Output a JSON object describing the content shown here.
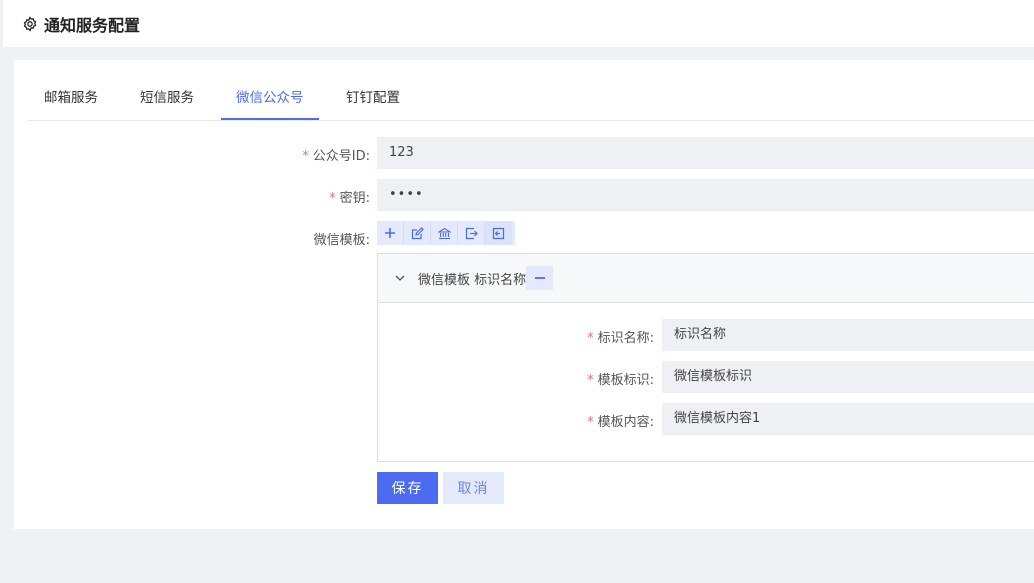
{
  "header": {
    "title": "通知服务配置",
    "icon": "gear-icon"
  },
  "tabs": [
    {
      "label": "邮箱服务",
      "active": false
    },
    {
      "label": "短信服务",
      "active": false
    },
    {
      "label": "微信公众号",
      "active": true
    },
    {
      "label": "钉钉配置",
      "active": false
    }
  ],
  "form": {
    "required_mark": "*",
    "app_id": {
      "label": "公众号ID:",
      "value": "123"
    },
    "secret": {
      "label": "密钥:",
      "value": "••••"
    },
    "templates": {
      "label": "微信模板:"
    }
  },
  "toolbar": {
    "icons": [
      "plus-icon",
      "edit-icon",
      "bank-icon",
      "export-icon",
      "import-icon"
    ]
  },
  "template_panel": {
    "title": "微信模板 标识名称",
    "fields": {
      "name": {
        "label": "标识名称:",
        "value": "标识名称"
      },
      "code": {
        "label": "模板标识:",
        "value": "微信模板标识"
      },
      "content": {
        "label": "模板内容:",
        "value": "微信模板内容1"
      }
    }
  },
  "actions": {
    "save_label": "保存",
    "cancel_label": "取消"
  },
  "colors": {
    "accent": "#4b6cf0",
    "required": "#f56c6c",
    "input_bg": "#eff0f4",
    "page_bg": "#f0f1f5"
  }
}
